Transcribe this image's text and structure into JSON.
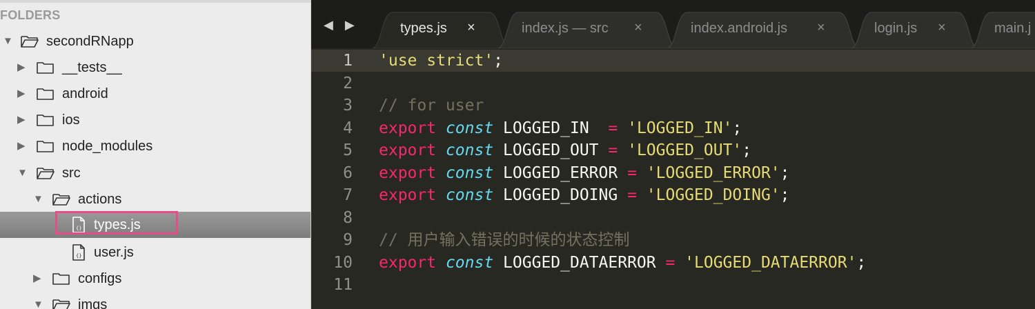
{
  "sidebar": {
    "header": "FOLDERS",
    "items": [
      {
        "label": "secondRNapp",
        "expanded": true,
        "kind": "folder"
      },
      {
        "label": "__tests__",
        "expanded": false,
        "kind": "folder"
      },
      {
        "label": "android",
        "expanded": false,
        "kind": "folder"
      },
      {
        "label": "ios",
        "expanded": false,
        "kind": "folder"
      },
      {
        "label": "node_modules",
        "expanded": false,
        "kind": "folder"
      },
      {
        "label": "src",
        "expanded": true,
        "kind": "folder"
      },
      {
        "label": "actions",
        "expanded": true,
        "kind": "folder"
      },
      {
        "label": "types.js",
        "kind": "file",
        "selected": true
      },
      {
        "label": "user.js",
        "kind": "file"
      },
      {
        "label": "configs",
        "expanded": false,
        "kind": "folder"
      },
      {
        "label": "imgs",
        "expanded": true,
        "kind": "folder"
      }
    ]
  },
  "tabs": [
    {
      "label": "types.js",
      "active": true
    },
    {
      "label": "index.js — src",
      "active": false
    },
    {
      "label": "index.android.js",
      "active": false
    },
    {
      "label": "login.js",
      "active": false
    },
    {
      "label": "main.j",
      "active": false
    }
  ],
  "tab_close_glyph": "×",
  "nav_glyphs": "◀ ▶",
  "editor": {
    "current_line": 1,
    "lines": [
      {
        "num": "1",
        "tokens": [
          {
            "t": "str",
            "v": "'use strict'"
          },
          {
            "t": "plain",
            "v": ";"
          }
        ]
      },
      {
        "num": "2",
        "tokens": []
      },
      {
        "num": "3",
        "tokens": [
          {
            "t": "cmt",
            "v": "// for user"
          }
        ]
      },
      {
        "num": "4",
        "tokens": [
          {
            "t": "kw",
            "v": "export"
          },
          {
            "t": "plain",
            "v": " "
          },
          {
            "t": "type",
            "v": "const"
          },
          {
            "t": "plain",
            "v": " LOGGED_IN  "
          },
          {
            "t": "op",
            "v": "="
          },
          {
            "t": "plain",
            "v": " "
          },
          {
            "t": "str",
            "v": "'LOGGED_IN'"
          },
          {
            "t": "plain",
            "v": ";"
          }
        ]
      },
      {
        "num": "5",
        "tokens": [
          {
            "t": "kw",
            "v": "export"
          },
          {
            "t": "plain",
            "v": " "
          },
          {
            "t": "type",
            "v": "const"
          },
          {
            "t": "plain",
            "v": " LOGGED_OUT "
          },
          {
            "t": "op",
            "v": "="
          },
          {
            "t": "plain",
            "v": " "
          },
          {
            "t": "str",
            "v": "'LOGGED_OUT'"
          },
          {
            "t": "plain",
            "v": ";"
          }
        ]
      },
      {
        "num": "6",
        "tokens": [
          {
            "t": "kw",
            "v": "export"
          },
          {
            "t": "plain",
            "v": " "
          },
          {
            "t": "type",
            "v": "const"
          },
          {
            "t": "plain",
            "v": " LOGGED_ERROR "
          },
          {
            "t": "op",
            "v": "="
          },
          {
            "t": "plain",
            "v": " "
          },
          {
            "t": "str",
            "v": "'LOGGED_ERROR'"
          },
          {
            "t": "plain",
            "v": ";"
          }
        ]
      },
      {
        "num": "7",
        "tokens": [
          {
            "t": "kw",
            "v": "export"
          },
          {
            "t": "plain",
            "v": " "
          },
          {
            "t": "type",
            "v": "const"
          },
          {
            "t": "plain",
            "v": " LOGGED_DOING "
          },
          {
            "t": "op",
            "v": "="
          },
          {
            "t": "plain",
            "v": " "
          },
          {
            "t": "str",
            "v": "'LOGGED_DOING'"
          },
          {
            "t": "plain",
            "v": ";"
          }
        ]
      },
      {
        "num": "8",
        "tokens": []
      },
      {
        "num": "9",
        "tokens": [
          {
            "t": "cmt",
            "v": "// 用户输入错误的时候的状态控制"
          }
        ]
      },
      {
        "num": "10",
        "tokens": [
          {
            "t": "kw",
            "v": "export"
          },
          {
            "t": "plain",
            "v": " "
          },
          {
            "t": "type",
            "v": "const"
          },
          {
            "t": "plain",
            "v": " LOGGED_DATAERROR "
          },
          {
            "t": "op",
            "v": "="
          },
          {
            "t": "plain",
            "v": " "
          },
          {
            "t": "str",
            "v": "'LOGGED_DATAERROR'"
          },
          {
            "t": "plain",
            "v": ";"
          }
        ]
      },
      {
        "num": "11",
        "tokens": []
      }
    ]
  },
  "colors": {
    "editor_bg": "#272822",
    "keyword": "#f92672",
    "type": "#66d9ef",
    "string": "#e6db74",
    "comment": "#75715e",
    "highlight_box": "#e74c8a"
  }
}
